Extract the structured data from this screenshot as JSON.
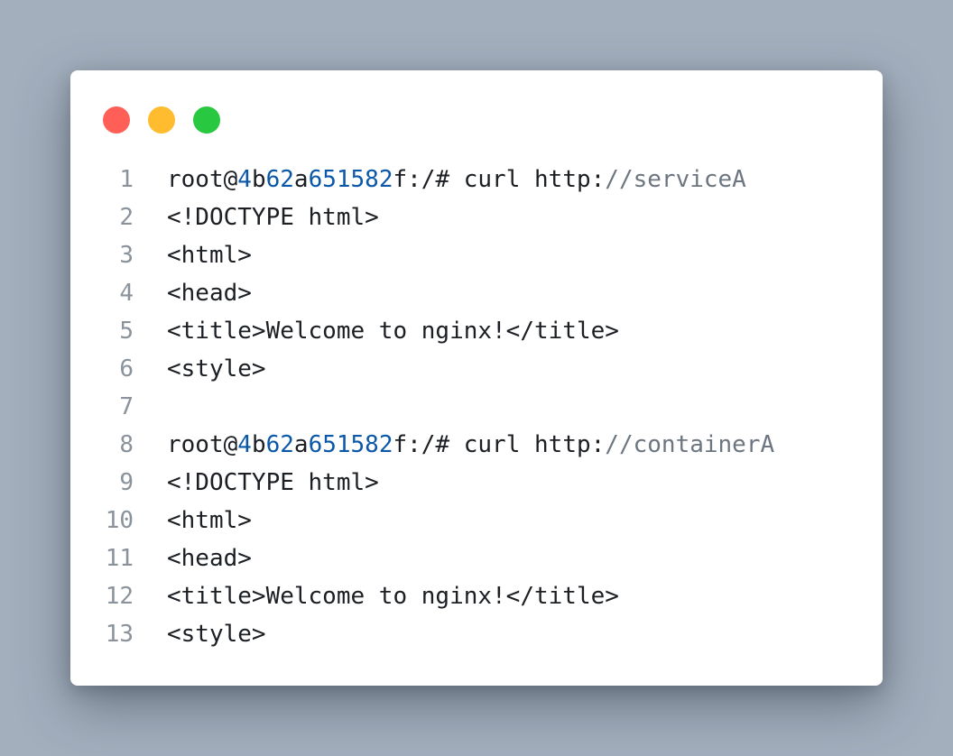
{
  "window": {
    "colors": {
      "page_background": "#a3afbd",
      "window_background": "#ffffff",
      "text": "#1b1f23",
      "line_number": "#8a929b",
      "number_token": "#0b57a8",
      "comment_token": "#6d7680"
    },
    "controls": [
      {
        "name": "close",
        "color": "#ff5f57"
      },
      {
        "name": "minimize",
        "color": "#febc2e"
      },
      {
        "name": "zoom",
        "color": "#28c840"
      }
    ]
  },
  "code": {
    "lines": [
      {
        "number": "1",
        "segments": [
          {
            "text": "root@",
            "style": "plain"
          },
          {
            "text": "4",
            "style": "hex"
          },
          {
            "text": "b",
            "style": "plain"
          },
          {
            "text": "62",
            "style": "hex"
          },
          {
            "text": "a",
            "style": "plain"
          },
          {
            "text": "651582",
            "style": "hex"
          },
          {
            "text": "f:/# curl http:",
            "style": "plain"
          },
          {
            "text": "//serviceA",
            "style": "comment"
          }
        ]
      },
      {
        "number": "2",
        "segments": [
          {
            "text": "<!DOCTYPE html>",
            "style": "plain"
          }
        ]
      },
      {
        "number": "3",
        "segments": [
          {
            "text": "<html>",
            "style": "plain"
          }
        ]
      },
      {
        "number": "4",
        "segments": [
          {
            "text": "<head>",
            "style": "plain"
          }
        ]
      },
      {
        "number": "5",
        "segments": [
          {
            "text": "<title>Welcome to nginx!</title>",
            "style": "plain"
          }
        ]
      },
      {
        "number": "6",
        "segments": [
          {
            "text": "<style>",
            "style": "plain"
          }
        ]
      },
      {
        "number": "7",
        "segments": []
      },
      {
        "number": "8",
        "segments": [
          {
            "text": "root@",
            "style": "plain"
          },
          {
            "text": "4",
            "style": "hex"
          },
          {
            "text": "b",
            "style": "plain"
          },
          {
            "text": "62",
            "style": "hex"
          },
          {
            "text": "a",
            "style": "plain"
          },
          {
            "text": "651582",
            "style": "hex"
          },
          {
            "text": "f:/# curl http:",
            "style": "plain"
          },
          {
            "text": "//containerA",
            "style": "comment"
          }
        ]
      },
      {
        "number": "9",
        "segments": [
          {
            "text": "<!DOCTYPE html>",
            "style": "plain"
          }
        ]
      },
      {
        "number": "10",
        "segments": [
          {
            "text": "<html>",
            "style": "plain"
          }
        ]
      },
      {
        "number": "11",
        "segments": [
          {
            "text": "<head>",
            "style": "plain"
          }
        ]
      },
      {
        "number": "12",
        "segments": [
          {
            "text": "<title>Welcome to nginx!</title>",
            "style": "plain"
          }
        ]
      },
      {
        "number": "13",
        "segments": [
          {
            "text": "<style>",
            "style": "plain"
          }
        ]
      }
    ]
  }
}
